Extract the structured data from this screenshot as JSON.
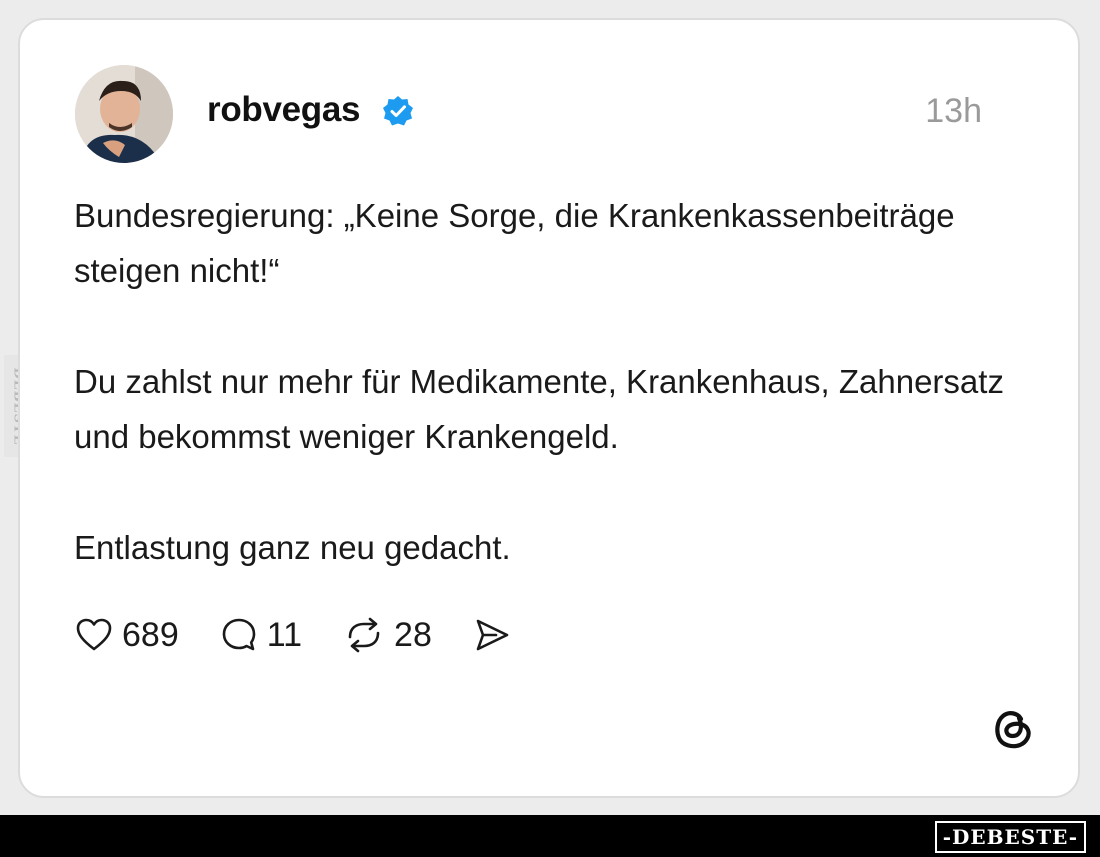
{
  "post": {
    "username": "robvegas",
    "verified": true,
    "time": "13h",
    "paragraphs": [
      "Bundesregierung: „Keine Sorge, die Krankenkassenbeiträge steigen nicht!“",
      "Du zahlst nur mehr für Medikamente, Krankenhaus, Zahnersatz und bekommst weniger Krankengeld.",
      "Entlastung ganz neu gedacht."
    ],
    "actions": {
      "likes": "689",
      "replies": "11",
      "reposts": "28"
    }
  },
  "icons": {
    "verified": "verified-badge-icon",
    "like": "heart-icon",
    "reply": "comment-bubble-icon",
    "repost": "repost-icon",
    "share": "send-icon",
    "brand": "threads-logo-icon"
  },
  "watermark": {
    "side": "DEBESTE",
    "footer": "-DEBESTE-"
  },
  "colors": {
    "verified": "#1d9bf0",
    "text": "#1a1a1a",
    "time": "#9a9a9a",
    "card_border": "#dcdcdc"
  }
}
